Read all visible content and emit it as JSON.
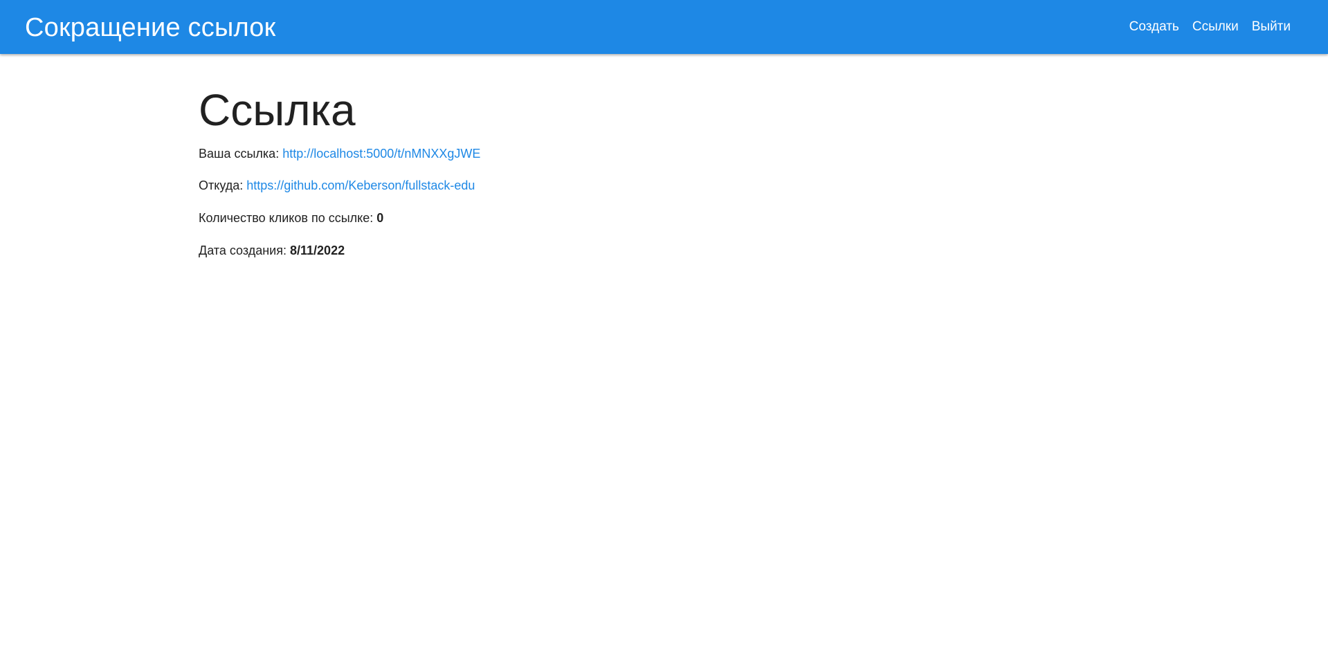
{
  "navbar": {
    "brand": "Сокращение ссылок",
    "links": [
      {
        "label": "Создать"
      },
      {
        "label": "Ссылки"
      },
      {
        "label": "Выйти"
      }
    ],
    "background_color": "#1e88e5"
  },
  "page": {
    "title": "Ссылка",
    "short_link_label": "Ваша ссылка:",
    "short_link_value": "http://localhost:5000/t/nMNXXgJWE",
    "from_label": "Откуда:",
    "from_value": "https://github.com/Keberson/fullstack-edu",
    "clicks_label": "Количество кликов по ссылке:",
    "clicks_value": "0",
    "date_label": "Дата создания:",
    "date_value": "8/11/2022"
  },
  "colors": {
    "accent": "#1e88e5",
    "text": "#212121",
    "link": "#1e88e5"
  }
}
